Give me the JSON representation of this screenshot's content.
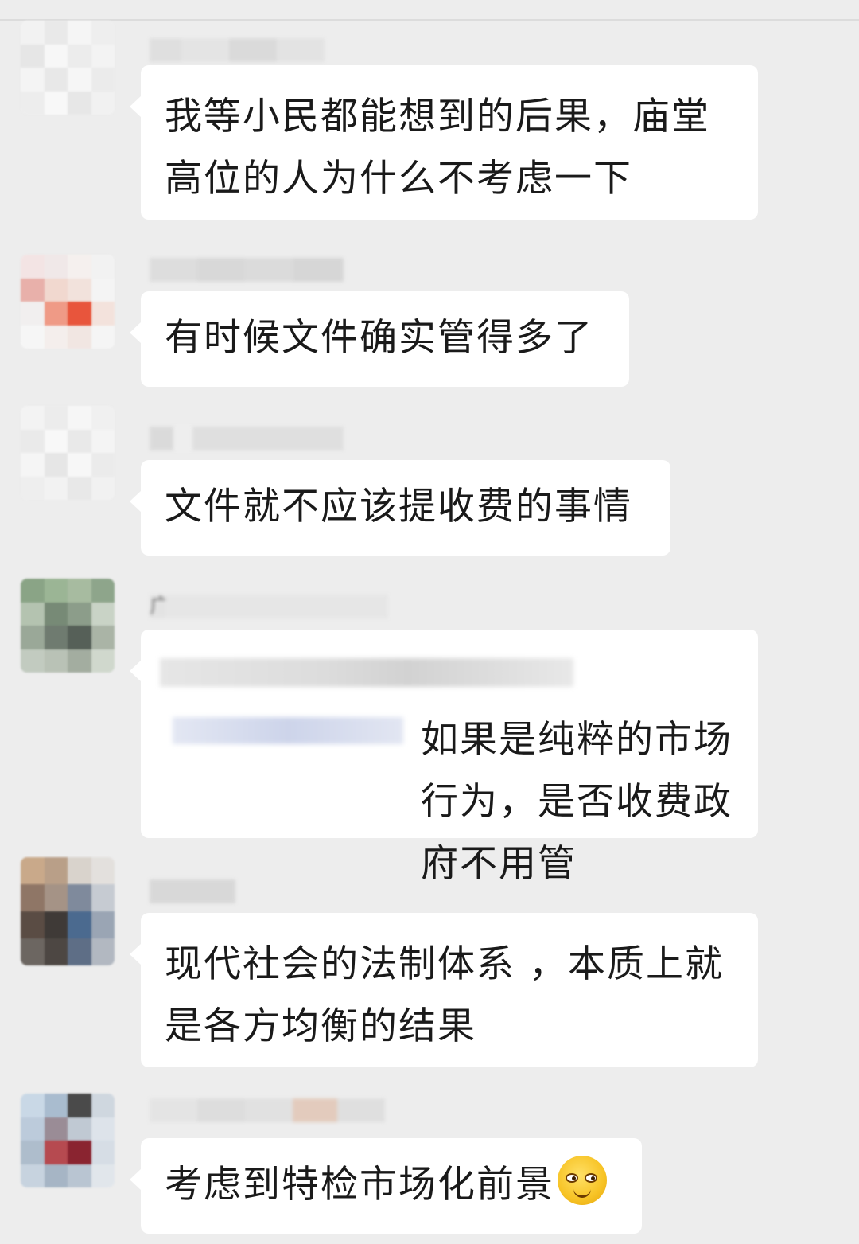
{
  "messages": [
    {
      "text": "我等小民都能想到的后果，庙堂\n高位的人为什么不考虑一下"
    },
    {
      "text": "有时候文件确实管得多了"
    },
    {
      "text": "文件就不应该提收费的事情"
    },
    {
      "quote_prefix": "广",
      "text": "如果是纯粹的市场\n行为，是否收费政府不用管"
    },
    {
      "text": "现代社会的法制体系 ，本质上就\n是各方均衡的结果"
    },
    {
      "text": "考虑到特检市场化前景",
      "emoji": "smirk-face-icon"
    }
  ]
}
